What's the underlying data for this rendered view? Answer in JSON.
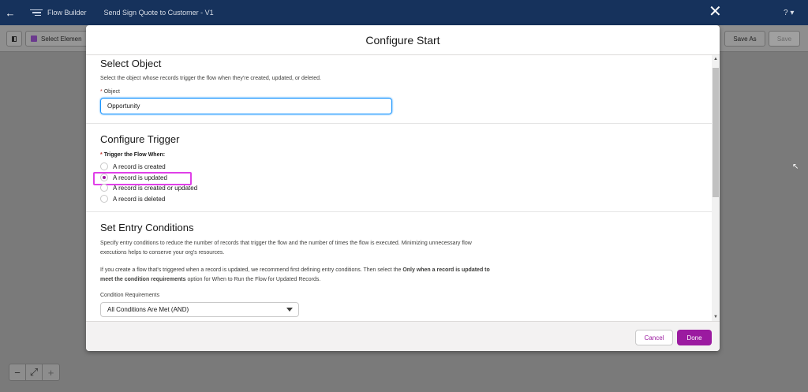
{
  "topbar": {
    "back_icon": "back-arrow-icon",
    "app_icon": "flow-builder-icon",
    "app_name": "Flow Builder",
    "flow_name": "Send Sign Quote to Customer - V1",
    "close_icon": "close-icon",
    "help_label": "? ▾"
  },
  "toolbar": {
    "select_elements_label": "Select Elemen",
    "save_as_label": "Save As",
    "save_label": "Save"
  },
  "zoom": {
    "zoom_out": "−",
    "fit": "⤢",
    "zoom_in": "+"
  },
  "modal": {
    "title": "Configure Start",
    "select_object": {
      "title": "Select Object",
      "description": "Select the object whose records trigger the flow when they're created, updated, or deleted.",
      "field_label_req": "*",
      "field_label": "Object",
      "field_value": "Opportunity"
    },
    "configure_trigger": {
      "title": "Configure Trigger",
      "label_req": "*",
      "label": "Trigger the Flow When:",
      "options": [
        {
          "label": "A record is created",
          "selected": false
        },
        {
          "label": "A record is updated",
          "selected": true
        },
        {
          "label": "A record is created or updated",
          "selected": false
        },
        {
          "label": "A record is deleted",
          "selected": false
        }
      ]
    },
    "entry_conditions": {
      "title": "Set Entry Conditions",
      "desc1a": "Specify entry conditions to reduce the number of records that trigger the flow and the number of times the flow is executed. Minimizing unnecessary flow",
      "desc1b": "executions helps to conserve your org's resources.",
      "desc2a_pre": "If you create a flow that's triggered when a record is updated, we recommend first defining entry conditions. Then select the ",
      "desc2a_bold": "Only when a record is updated to",
      "desc2b_bold": "meet the condition requirements",
      "desc2b_post": " option for When to Run the Flow for Updated Records.",
      "condition_label": "Condition Requirements",
      "condition_value": "All Conditions Are Met (AND)"
    },
    "cancel_label": "Cancel",
    "done_label": "Done"
  },
  "colors": {
    "header_bg": "#16325c",
    "brand_accent": "#9b1aa0",
    "highlight": "#e040e8",
    "focus_blue": "#1b96ff"
  }
}
